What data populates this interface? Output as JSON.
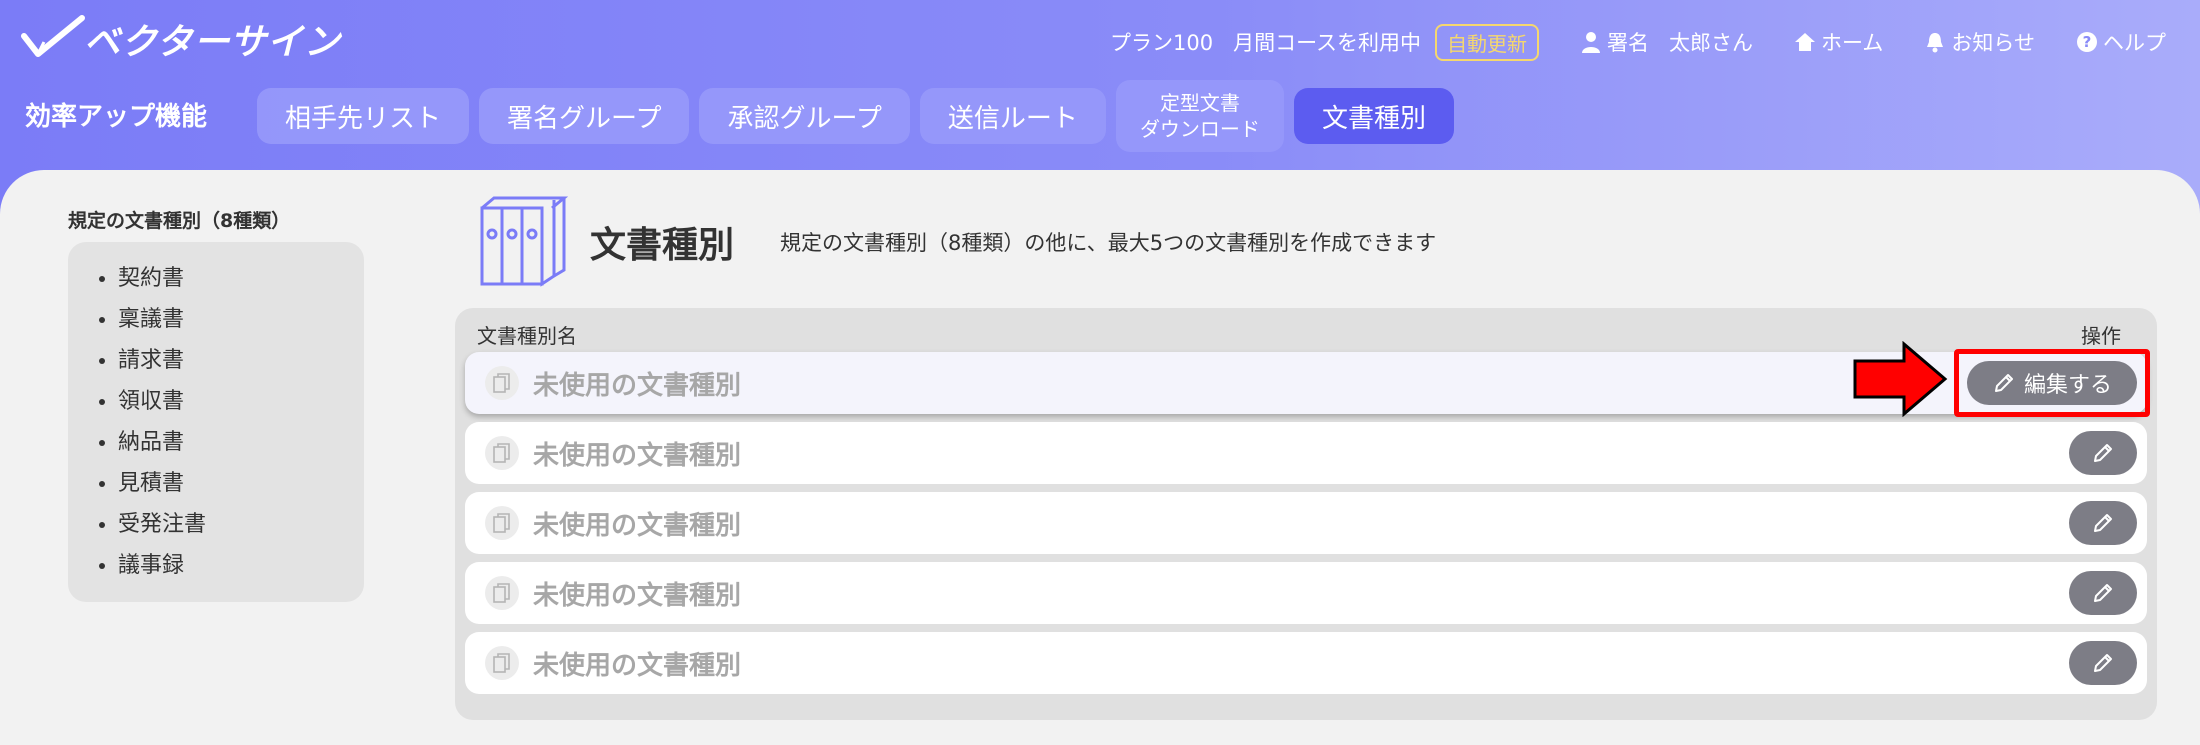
{
  "app": {
    "name": "ベクターサイン"
  },
  "header": {
    "plan": "プラン100",
    "course": "月間コースを利用中",
    "auto_renew": "自動更新",
    "user_role": "署名",
    "user_name": "太郎さん",
    "home": "ホーム",
    "notice": "お知らせ",
    "help": "ヘルプ"
  },
  "feature": {
    "label": "効率アップ機能",
    "tabs": [
      {
        "label": "相手先リスト"
      },
      {
        "label": "署名グループ"
      },
      {
        "label": "承認グループ"
      },
      {
        "label": "送信ルート"
      },
      {
        "line1": "定型文書",
        "line2": "ダウンロード"
      },
      {
        "label": "文書種別"
      }
    ]
  },
  "sidebar": {
    "title": "規定の文書種別（8種類）",
    "items": [
      "契約書",
      "稟議書",
      "請求書",
      "領収書",
      "納品書",
      "見積書",
      "受発注書",
      "議事録"
    ]
  },
  "main": {
    "title": "文書種別",
    "description": "規定の文書種別（8種類）の他に、最大5つの文書種別を作成できます",
    "table": {
      "col_name": "文書種別名",
      "col_op": "操作",
      "rows": [
        {
          "label": "未使用の文書種別"
        },
        {
          "label": "未使用の文書種別"
        },
        {
          "label": "未使用の文書種別"
        },
        {
          "label": "未使用の文書種別"
        },
        {
          "label": "未使用の文書種別"
        }
      ],
      "edit_label": "編集する"
    }
  },
  "colors": {
    "accent": "#5c5cf0",
    "header_gradient_start": "#7b7cf7",
    "badge": "#f5d76e",
    "highlight": "#ff0000"
  }
}
